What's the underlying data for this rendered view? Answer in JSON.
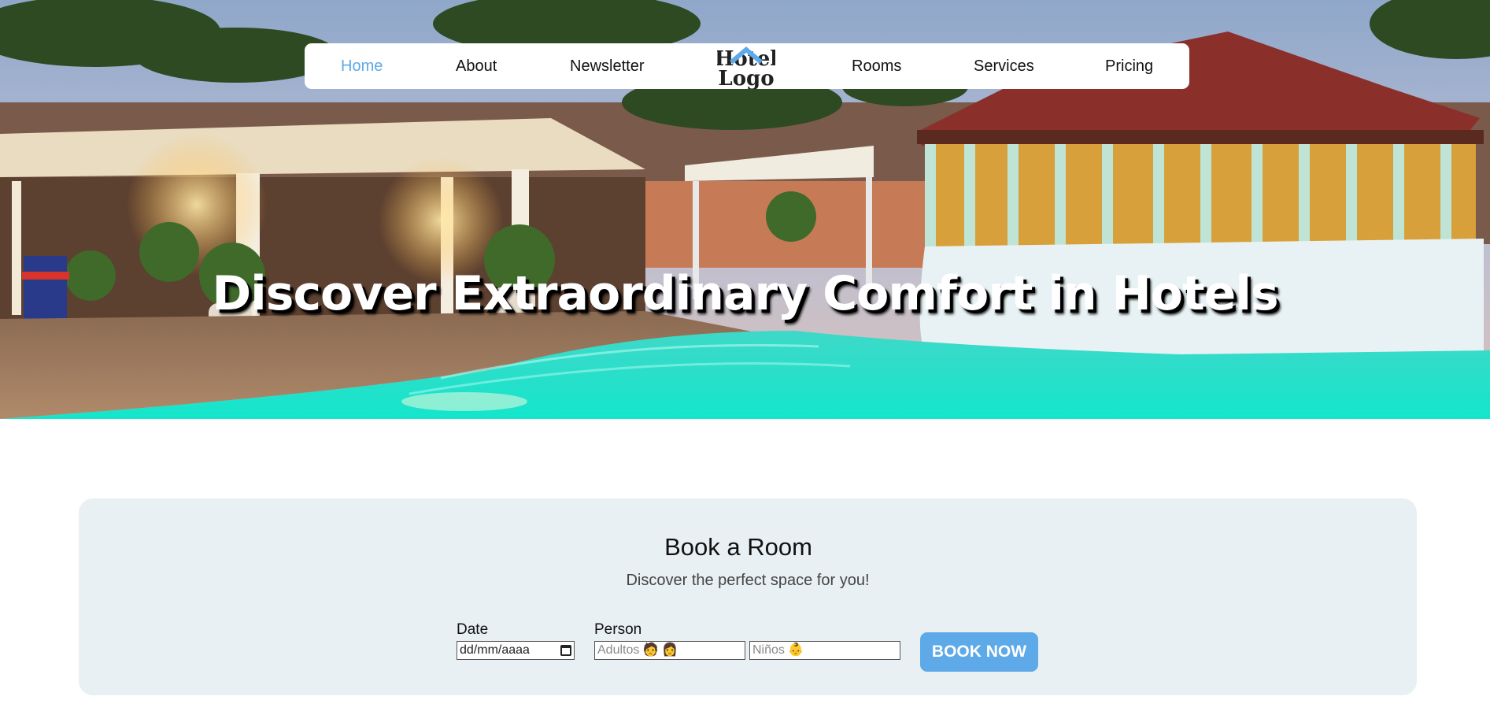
{
  "nav": {
    "items": [
      {
        "label": "Home",
        "active": true
      },
      {
        "label": "About"
      },
      {
        "label": "Newsletter"
      },
      {
        "label": "Rooms"
      },
      {
        "label": "Services"
      },
      {
        "label": "Pricing"
      }
    ],
    "logo_text": {
      "line1": "Hotel",
      "line2": "Logo"
    }
  },
  "hero": {
    "title": "Discover Extraordinary Comfort in Hotels",
    "image": "hotel-pool-night-photo"
  },
  "booking": {
    "title": "Book a Room",
    "subtitle": "Discover the perfect space for you!",
    "date_label": "Date",
    "date_value": "dd/mm/aaaa",
    "person_label": "Person",
    "adults_placeholder": "Adultos 🧑 👩",
    "children_placeholder": "Niños 👶",
    "button_label": "BOOK NOW"
  },
  "colors": {
    "accent": "#5ea9e8",
    "panel": "#e8f0f3",
    "nav_bg": "#ffffff"
  }
}
